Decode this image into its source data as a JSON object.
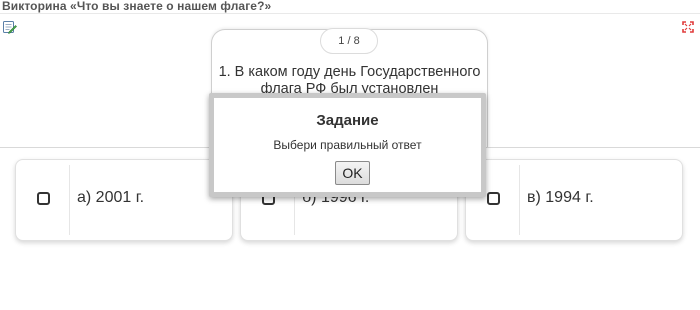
{
  "header": {
    "title": "Викторина «Что вы знаете о нашем флаге?»",
    "edit_icon": "edit-note-icon",
    "fullscreen_icon": "fullscreen-icon"
  },
  "question": {
    "counter": "1 / 8",
    "text": "1. В каком году день Государственного флага РФ был установлен"
  },
  "answers": [
    {
      "label": "а) 2001 г."
    },
    {
      "label": "б) 1996 г."
    },
    {
      "label": "в) 1994 г."
    }
  ],
  "dialog": {
    "title": "Задание",
    "message": "Выбери правильный ответ",
    "ok_label": "OK"
  },
  "colors": {
    "text": "#333333",
    "card_border": "#e0e0e0",
    "dialog_border": "#c8c8c8",
    "edit_icon_green": "#4caf50",
    "fullscreen_icon_red": "#e03b3b"
  }
}
